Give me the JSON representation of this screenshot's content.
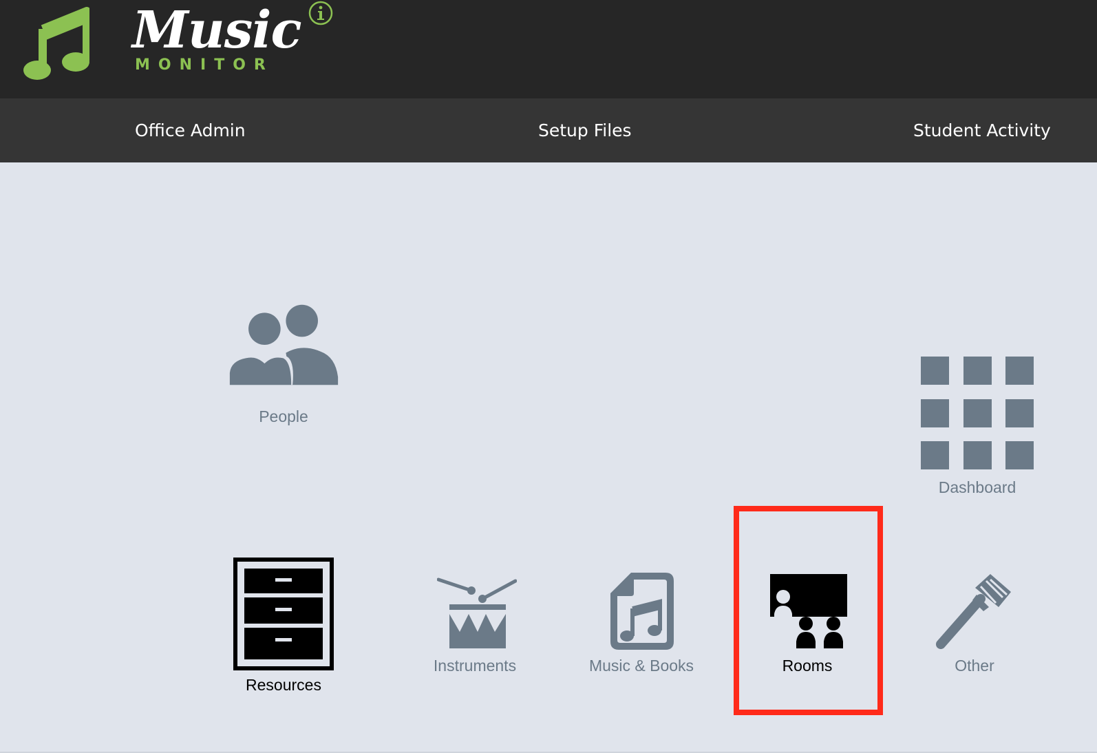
{
  "app": {
    "logo_word": "Music",
    "logo_sub": "MONITOR"
  },
  "nav": {
    "items": [
      {
        "label": "Office Admin"
      },
      {
        "label": "Setup Files"
      },
      {
        "label": "Student Activity"
      }
    ]
  },
  "tiles": {
    "people": {
      "label": "People",
      "icon": "people-icon"
    },
    "dashboard": {
      "label": "Dashboard",
      "icon": "grid-icon"
    },
    "resources": {
      "label": "Resources",
      "icon": "filing-cabinet-icon"
    },
    "instruments": {
      "label": "Instruments",
      "icon": "drum-icon"
    },
    "music_books": {
      "label": "Music & Books",
      "icon": "music-file-icon"
    },
    "rooms": {
      "label": "Rooms",
      "icon": "classroom-icon",
      "highlighted": true
    },
    "other": {
      "label": "Other",
      "icon": "microphone-icon"
    }
  },
  "colors": {
    "header_bg": "#262626",
    "nav_bg": "#353535",
    "page_bg": "#e0e4ec",
    "brand_green": "#8cc152",
    "icon_gray": "#6b7a88",
    "highlight_red": "#ff2a1a"
  }
}
